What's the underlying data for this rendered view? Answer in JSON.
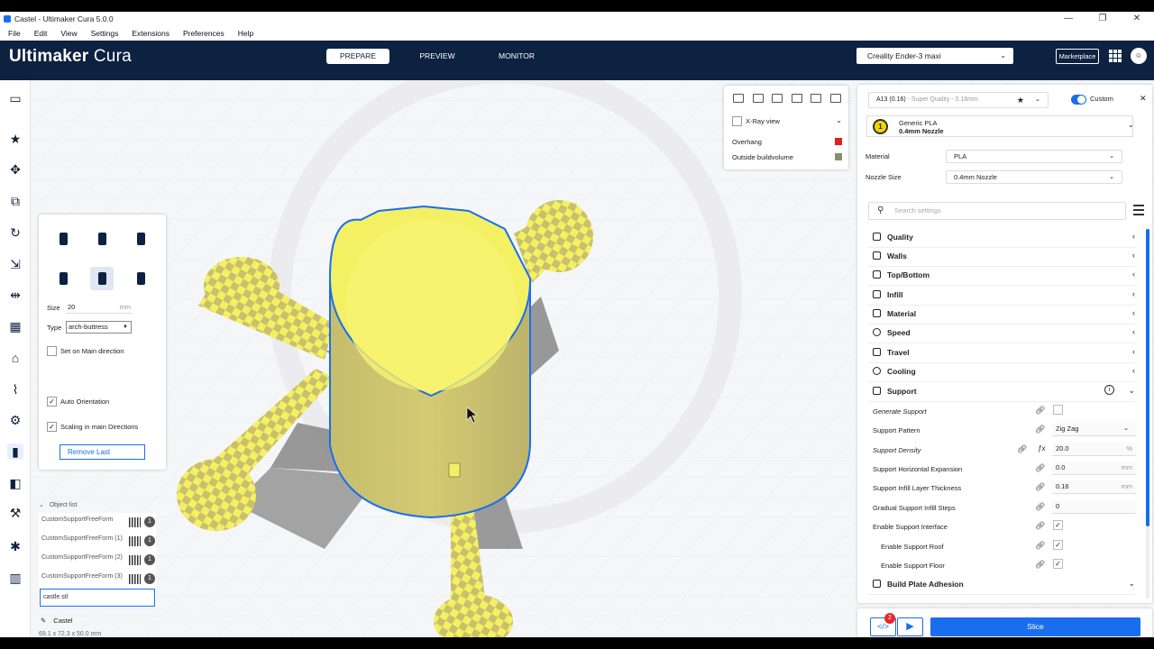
{
  "window": {
    "title": "Castel - Ultimaker Cura 5.0.0",
    "minimize": "—",
    "restore": "❐",
    "close": "✕"
  },
  "menu": [
    "File",
    "Edit",
    "View",
    "Settings",
    "Extensions",
    "Preferences",
    "Help"
  ],
  "header": {
    "logo_bold": "Ultimaker",
    "logo_light": " Cura",
    "tabs": [
      "PREPARE",
      "PREVIEW",
      "MONITOR"
    ],
    "active_tab": "PREPARE",
    "printer": "Creality Ender-3 maxi",
    "marketplace": "Marketplace"
  },
  "tool_panel": {
    "size_label": "Size",
    "size_value": "20",
    "size_unit": "mm",
    "type_label": "Type",
    "type_value": "arch-buttress",
    "main_direction": "Set on Main direction",
    "auto_orientation": "Auto Orientation",
    "scaling": "Scaling in main Directions",
    "remove_last": "Remove Last"
  },
  "object_list": {
    "header": "Object list",
    "items": [
      {
        "name": "CustomSupportFreeForm",
        "count": "1"
      },
      {
        "name": "CustomSupportFreeForm (1)",
        "count": "1"
      },
      {
        "name": "CustomSupportFreeForm (2)",
        "count": "1"
      },
      {
        "name": "CustomSupportFreeForm (3)",
        "count": "1"
      }
    ],
    "input": "castle.stl",
    "object_name": "Castel",
    "dimensions": "69.1 x 72.3 x 50.0 mm"
  },
  "view_panel": {
    "xray": "X-Ray view",
    "overhang": "Overhang",
    "outside": "Outside buildvolume",
    "overhang_color": "#e0201c",
    "outside_color": "#8b8e6a"
  },
  "settings": {
    "profile_name": "A13 (0.16)",
    "profile_detail": " - Super Quality - 0.16mm",
    "custom_label": "Custom",
    "extruder_number": "1",
    "extruder_material": "Generic PLA",
    "extruder_nozzle": "0.4mm Nozzle",
    "material_label": "Material",
    "material_value": "PLA",
    "nozzle_label": "Nozzle Size",
    "nozzle_value": "0.4mm Nozzle",
    "search_placeholder": "Search settings",
    "categories": [
      "Quality",
      "Walls",
      "Top/Bottom",
      "Infill",
      "Material",
      "Speed",
      "Travel",
      "Cooling",
      "Support"
    ],
    "support_rows": {
      "generate_support": "Generate Support",
      "support_pattern": "Support Pattern",
      "support_pattern_value": "Zig Zag",
      "support_density": "Support Density",
      "support_density_value": "20.0",
      "support_density_unit": "%",
      "horizontal_expansion": "Support Horizontal Expansion",
      "horizontal_expansion_value": "0.0",
      "infill_layer_thickness": "Support Infill Layer Thickness",
      "infill_layer_thickness_value": "0.16",
      "gradual_steps": "Gradual Support Infill Steps",
      "gradual_steps_value": "0",
      "enable_interface": "Enable Support Interface",
      "enable_roof": "Enable Support Roof",
      "enable_floor": "Enable Support Floor",
      "unit_mm": "mm"
    },
    "build_plate": "Build Plate Adhesion"
  },
  "action": {
    "notifications": "2",
    "slice": "Slice"
  },
  "colors": {
    "accent": "#196ef0",
    "header": "#0d2140",
    "model": "#f4f064",
    "model_shade": "#c9c06c",
    "selection": "#196ef0"
  }
}
